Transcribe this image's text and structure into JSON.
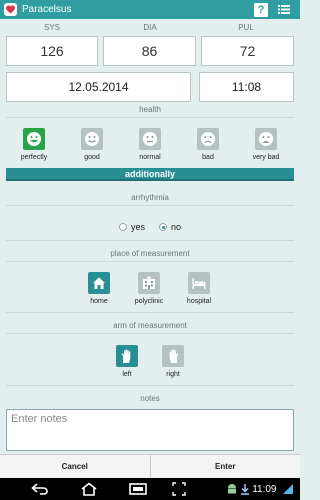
{
  "app": {
    "title": "Paracelsus",
    "help_label": "?"
  },
  "vitals": {
    "columns": [
      {
        "label": "SYS",
        "value": "126"
      },
      {
        "label": "DIA",
        "value": "86"
      },
      {
        "label": "PUL",
        "value": "72"
      }
    ]
  },
  "date": "12.05.2014",
  "time": "11:08",
  "health": {
    "label": "health",
    "options": [
      {
        "label": "perfectly",
        "icon": "smile-happy-icon",
        "selected": true
      },
      {
        "label": "good",
        "icon": "smile-icon",
        "selected": false
      },
      {
        "label": "normal",
        "icon": "neutral-face-icon",
        "selected": false
      },
      {
        "label": "bad",
        "icon": "frown-icon",
        "selected": false
      },
      {
        "label": "very bad",
        "icon": "very-sad-face-icon",
        "selected": false
      }
    ]
  },
  "additionally_label": "additionally",
  "arrhythmia": {
    "label": "arrhythmia",
    "yes": "yes",
    "no": "no",
    "selected": "no"
  },
  "place": {
    "label": "place of measurement",
    "options": [
      {
        "label": "home",
        "icon": "home-icon",
        "selected": true
      },
      {
        "label": "polyclinic",
        "icon": "polyclinic-icon",
        "selected": false
      },
      {
        "label": "hospital",
        "icon": "hospital-bed-icon",
        "selected": false
      }
    ]
  },
  "arm": {
    "label": "arm of measurement",
    "options": [
      {
        "label": "left",
        "icon": "left-hand-icon",
        "selected": true
      },
      {
        "label": "right",
        "icon": "right-hand-icon",
        "selected": false
      }
    ]
  },
  "notes": {
    "label": "notes",
    "placeholder": "Enter notes"
  },
  "actions": {
    "cancel": "Cancel",
    "enter": "Enter"
  },
  "system": {
    "clock": "11:09"
  },
  "colors": {
    "accent": "#2f9da1",
    "selected_face": "#2aa44a",
    "inactive": "#b6c1c1"
  }
}
